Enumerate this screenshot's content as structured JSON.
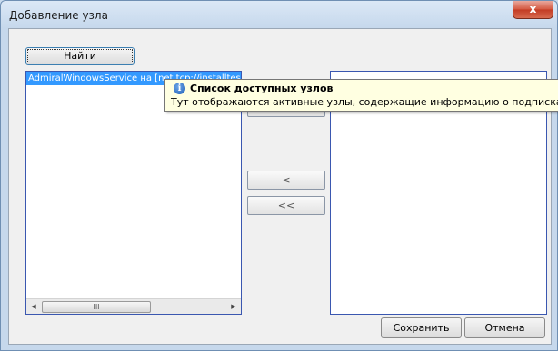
{
  "window": {
    "title": "Добавление узла",
    "close_glyph": "x"
  },
  "toolbar": {
    "find_label": "Найти"
  },
  "left_list": {
    "items": [
      "AdmiralWindowsService на [net.tcp://installtest:8"
    ],
    "scroll_left_glyph": "◀",
    "scroll_right_glyph": "▶",
    "scroll_thumb_grip": "III"
  },
  "move_buttons": {
    "add_all": ">>",
    "remove": "<",
    "remove_all": "<<"
  },
  "tooltip": {
    "icon_glyph": "i",
    "title": "Список доступных узлов",
    "text": "Тут отображаются активные узлы, содержащие информацию о подписках на котор"
  },
  "footer": {
    "save_label": "Сохранить",
    "cancel_label": "Отмена"
  },
  "colors": {
    "selection": "#3399ff",
    "list_border": "#3a57b0",
    "tooltip_bg": "#ffffe1"
  }
}
